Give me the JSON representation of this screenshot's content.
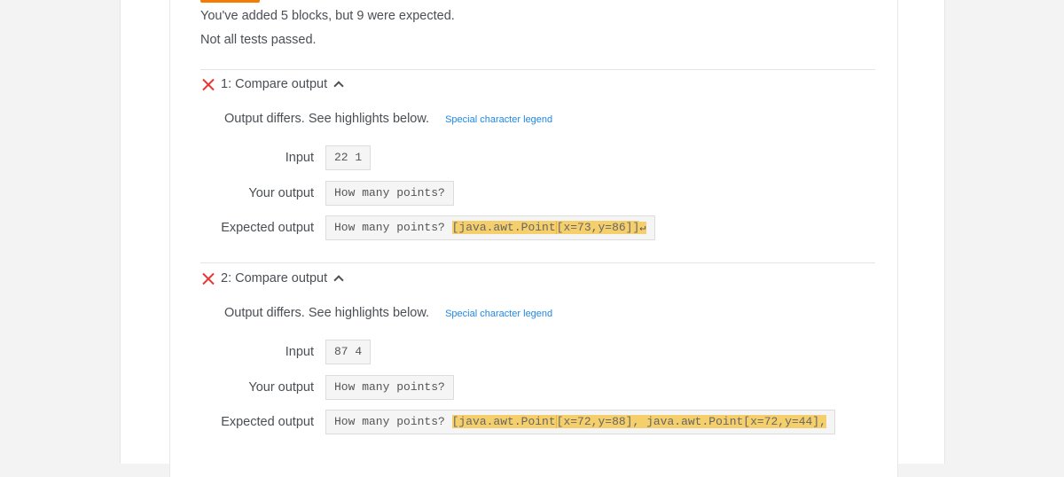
{
  "summary": {
    "blocks_message": "You've added 5 blocks, but 9 were expected.",
    "tests_message": "Not all tests passed."
  },
  "tests": [
    {
      "title": "1: Compare output",
      "status": "failed",
      "status_icon": "x-icon",
      "toggle_icon": "chevron-up-icon",
      "differs_text": "Output differs. See highlights below.",
      "legend_link": "Special character legend",
      "input_label": "Input",
      "input_value": "22 1",
      "your_output_label": "Your output",
      "your_output_value": "How many points?",
      "expected_label": "Expected output",
      "expected_plain": "How many points? ",
      "expected_highlight_1": "[java.awt.Point",
      "expected_highlight_2": "[x=73,y=86]]",
      "expected_newline_symbol": "↵"
    },
    {
      "title": "2: Compare output",
      "status": "failed",
      "status_icon": "x-icon",
      "toggle_icon": "chevron-up-icon",
      "differs_text": "Output differs. See highlights below.",
      "legend_link": "Special character legend",
      "input_label": "Input",
      "input_value": "87 4",
      "your_output_label": "Your output",
      "your_output_value": "How many points?",
      "expected_label": "Expected output",
      "expected_plain": "How many points? ",
      "expected_highlight_1": "[java.awt.Point",
      "expected_highlight_2": "[x=72,y=88], java.awt.Point[x=72,y=44],"
    }
  ],
  "colors": {
    "accent_orange": "#f57c00",
    "fail_red": "#e53935",
    "link_blue": "#1e88e5",
    "diff_highlight": "#f5cf6b"
  }
}
